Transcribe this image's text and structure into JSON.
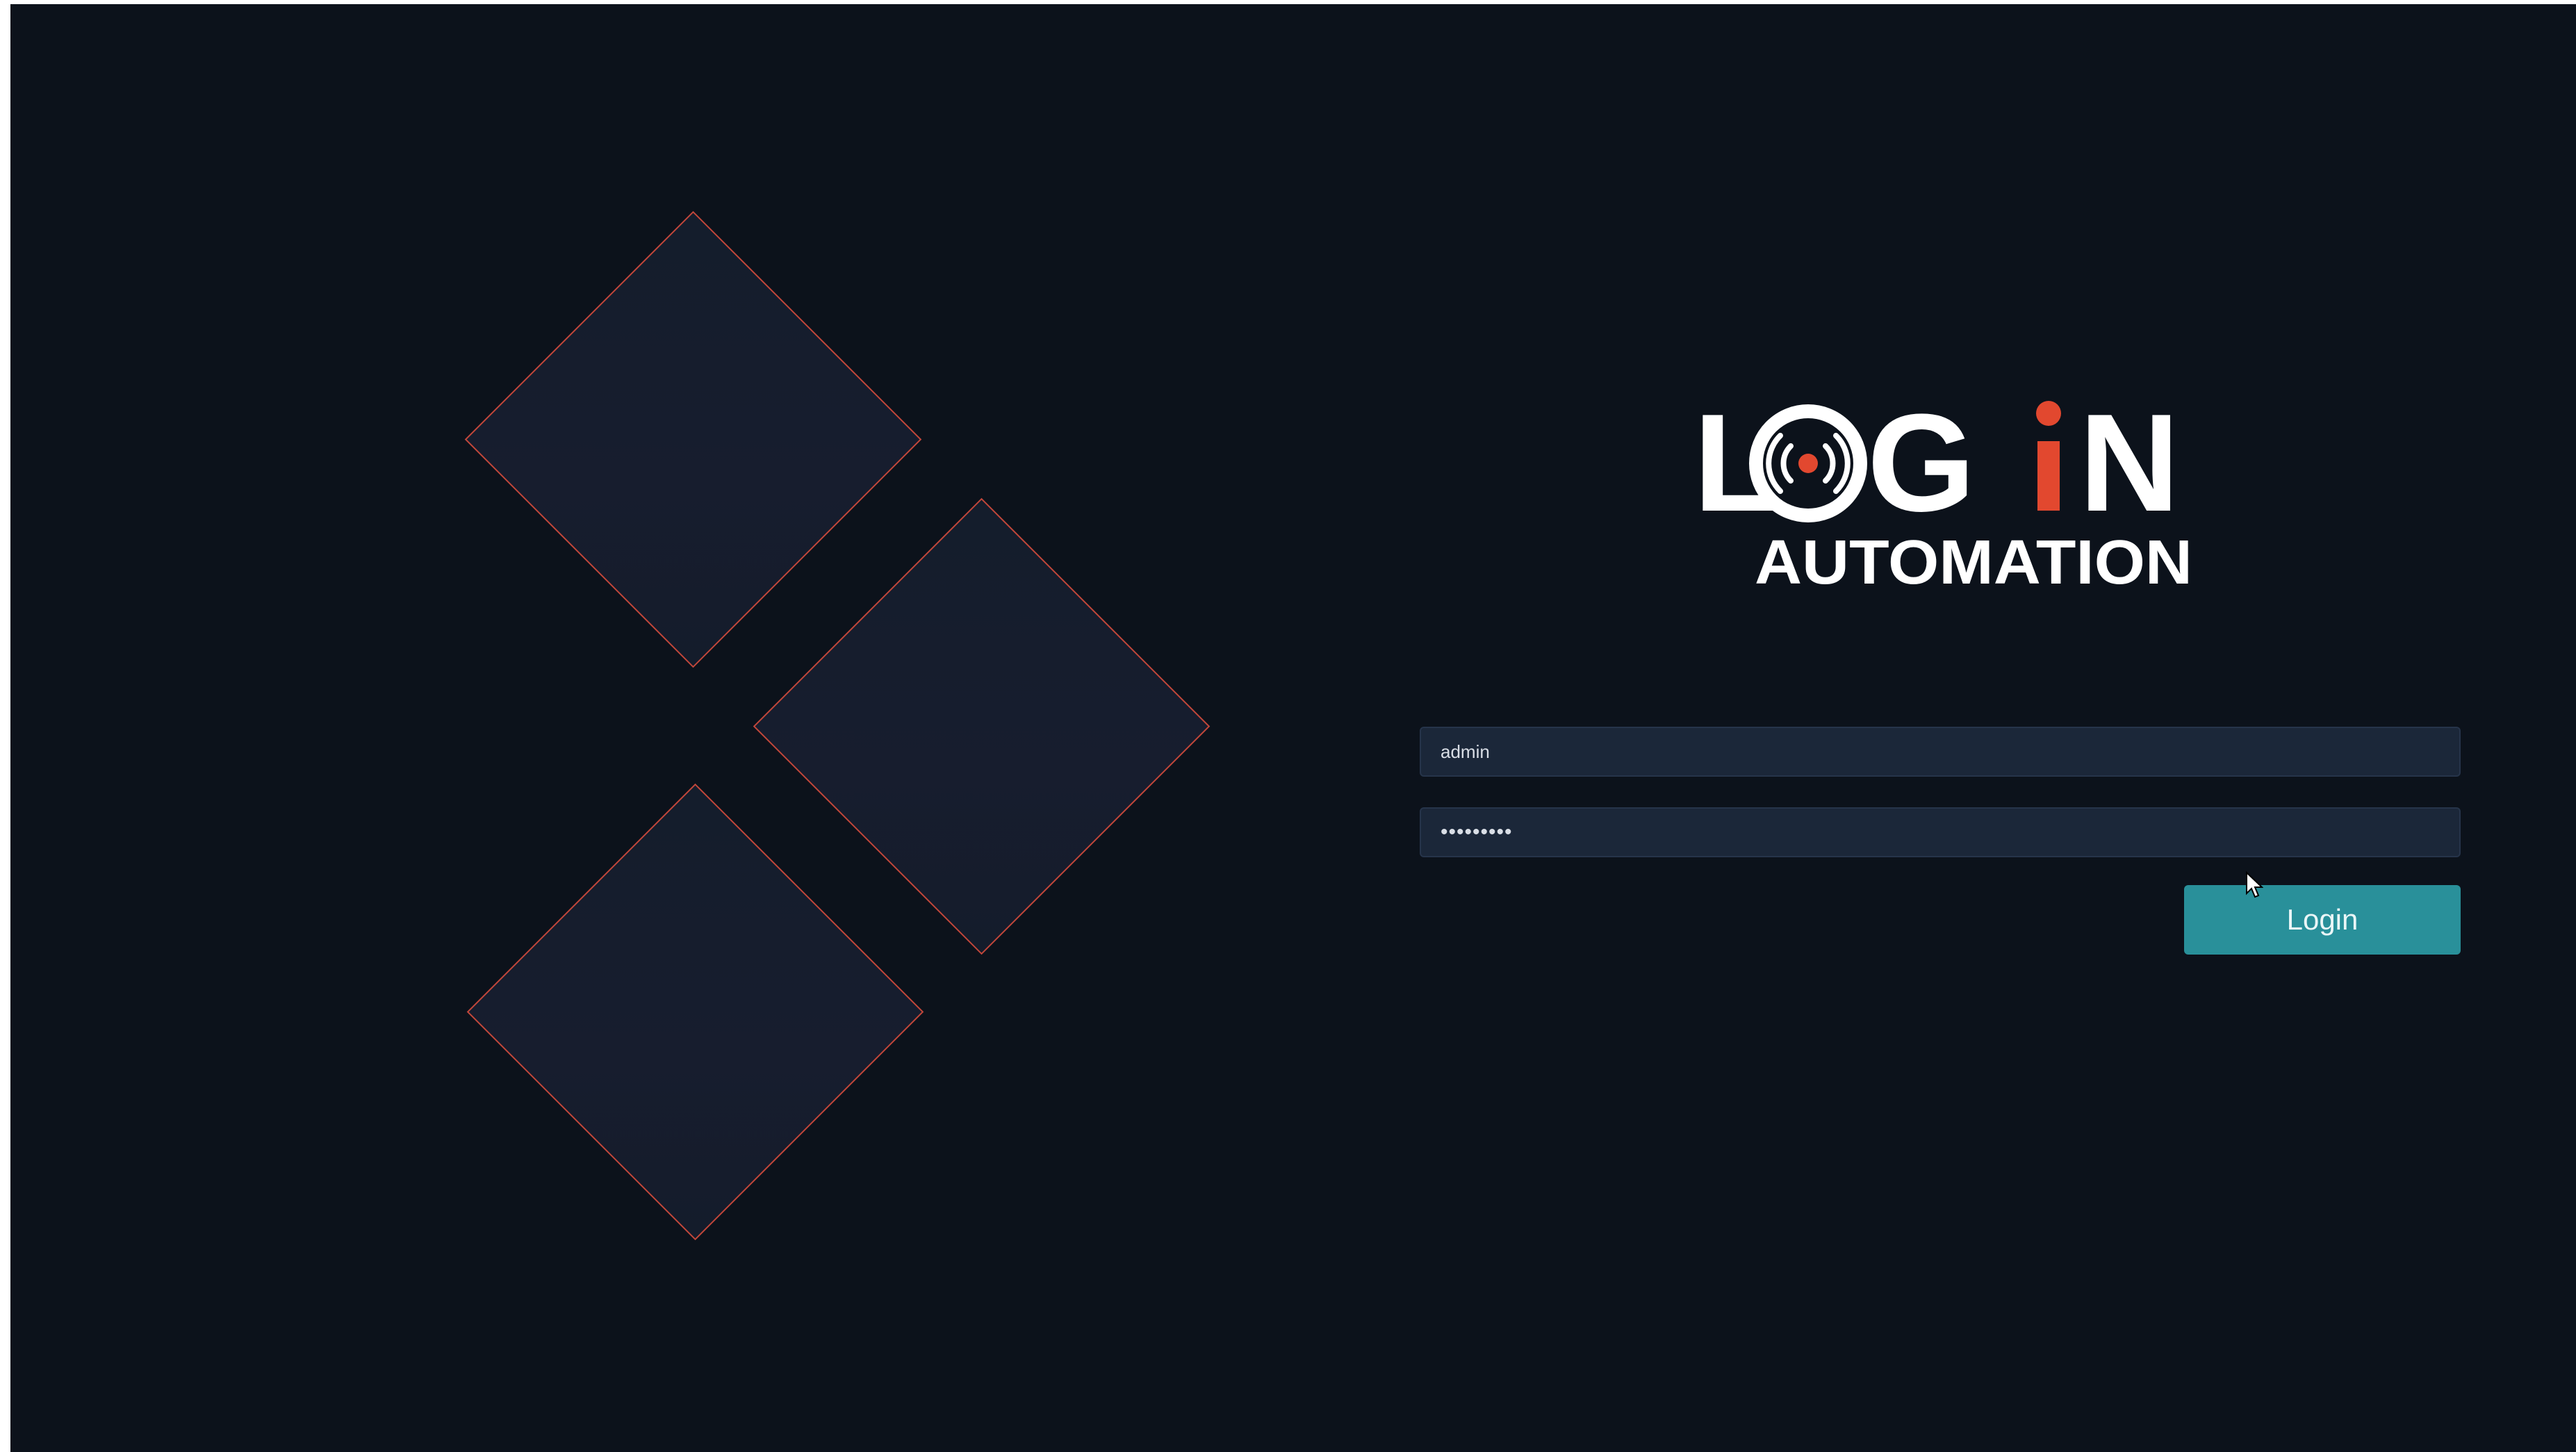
{
  "logo": {
    "line1": "LOG iN",
    "line2": "AUTOMATION",
    "colors": {
      "text": "#ffffff",
      "accent": "#e2482f"
    }
  },
  "form": {
    "username_value": "admin",
    "password_value": "password1",
    "login_label": "Login"
  },
  "colors": {
    "background": "#0c121b",
    "field_bg": "#1b2739",
    "button": "#29909a",
    "diamond_border": "#c2473b"
  }
}
